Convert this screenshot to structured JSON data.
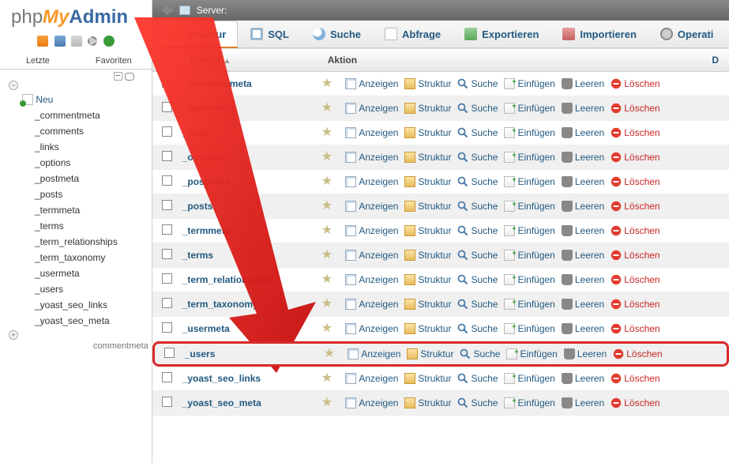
{
  "logo": {
    "php": "php",
    "my": "My",
    "admin": "Admin"
  },
  "server": {
    "label": "Server:"
  },
  "recent_tabs": [
    "Letzte",
    "Favoriten"
  ],
  "tree": {
    "new": "Neu",
    "tables": [
      "_commentmeta",
      "_comments",
      "_links",
      "_options",
      "_postmeta",
      "_posts",
      "_termmeta",
      "_terms",
      "_term_relationships",
      "_term_taxonomy",
      "_usermeta",
      "_users",
      "_yoast_seo_links",
      "_yoast_seo_meta"
    ],
    "footer": "commentmeta"
  },
  "tabs": {
    "struktur": "Struktur",
    "sql": "SQL",
    "suche": "Suche",
    "abfrage": "Abfrage",
    "exportieren": "Exportieren",
    "importieren": "Importieren",
    "operationen": "Operati"
  },
  "headers": {
    "tabelle": "Tabelle",
    "aktion": "Aktion",
    "d": "D"
  },
  "actions": {
    "anzeigen": "Anzeigen",
    "struktur": "Struktur",
    "suche": "Suche",
    "einfuegen": "Einfügen",
    "leeren": "Leeren",
    "loeschen": "Löschen"
  },
  "rows": [
    {
      "name": "_commentmeta",
      "alt": false
    },
    {
      "name": "_comments",
      "alt": true
    },
    {
      "name": "_links",
      "alt": false
    },
    {
      "name": "_options",
      "alt": true
    },
    {
      "name": "_postmeta",
      "alt": false
    },
    {
      "name": "_posts",
      "alt": true
    },
    {
      "name": "_termmeta",
      "alt": false
    },
    {
      "name": "_terms",
      "alt": true
    },
    {
      "name": "_term_relationships",
      "alt": false
    },
    {
      "name": "_term_taxonomy",
      "alt": true
    },
    {
      "name": "_usermeta",
      "alt": false
    },
    {
      "name": "_users",
      "alt": true,
      "highlight": true
    },
    {
      "name": "_yoast_seo_links",
      "alt": false
    },
    {
      "name": "_yoast_seo_meta",
      "alt": true
    }
  ]
}
